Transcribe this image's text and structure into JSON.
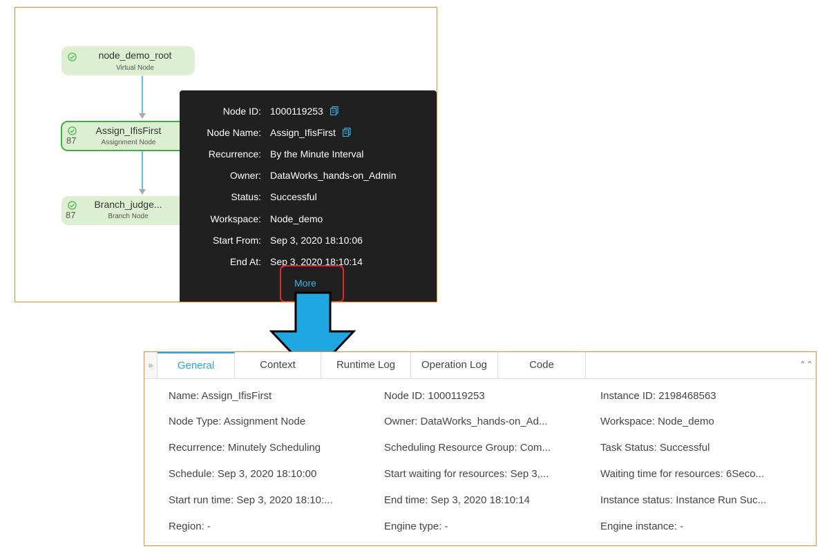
{
  "dag": {
    "nodes": [
      {
        "name": "node_demo_root",
        "type": "Virtual Node",
        "count": ""
      },
      {
        "name": "Assign_IfisFirst",
        "type": "Assignment Node",
        "count": "87"
      },
      {
        "name": "Branch_judge...",
        "type": "Branch Node",
        "count": "87"
      }
    ]
  },
  "tooltip": {
    "rows": [
      {
        "label": "Node ID:",
        "value": "1000119253"
      },
      {
        "label": "Node Name:",
        "value": "Assign_IfisFirst"
      },
      {
        "label": "Recurrence:",
        "value": "By the Minute Interval"
      },
      {
        "label": "Owner:",
        "value": "DataWorks_hands-on_Admin"
      },
      {
        "label": "Status:",
        "value": "Successful"
      },
      {
        "label": "Workspace:",
        "value": "Node_demo"
      },
      {
        "label": "Start From:",
        "value": "Sep 3, 2020 18:10:06"
      },
      {
        "label": "End At:",
        "value": "Sep 3, 2020 18:10:14"
      }
    ],
    "more_label": "More"
  },
  "details": {
    "collapse_left": "»",
    "collapse_right": "⌃⌃",
    "tabs": [
      "General",
      "Context",
      "Runtime Log",
      "Operation Log",
      "Code"
    ],
    "fields": [
      [
        "Name:  Assign_IfisFirst",
        "Node ID:  1000119253",
        "Instance ID:  2198468563"
      ],
      [
        "Node Type:  Assignment Node",
        "Owner:  DataWorks_hands-on_Ad...",
        "Workspace:  Node_demo"
      ],
      [
        "Recurrence:  Minutely Scheduling",
        "Scheduling Resource Group:  Com...",
        "Task Status:  Successful"
      ],
      [
        "Schedule:  Sep 3, 2020 18:10:00",
        "Start waiting for resources:  Sep 3,...",
        "Waiting time for resources:  6Seco..."
      ],
      [
        "Start run time:  Sep 3, 2020 18:10:...",
        "End time:  Sep 3, 2020 18:10:14",
        "Instance status:  Instance Run Suc..."
      ],
      [
        "Region:  -",
        "Engine type:  -",
        "Engine instance:  -"
      ]
    ]
  },
  "colors": {
    "highlight_border": "#f08a34",
    "accent": "#29a6d6",
    "node_fill": "#dcefd0",
    "tooltip_bg": "#202020",
    "more_outline": "#e5262a"
  }
}
